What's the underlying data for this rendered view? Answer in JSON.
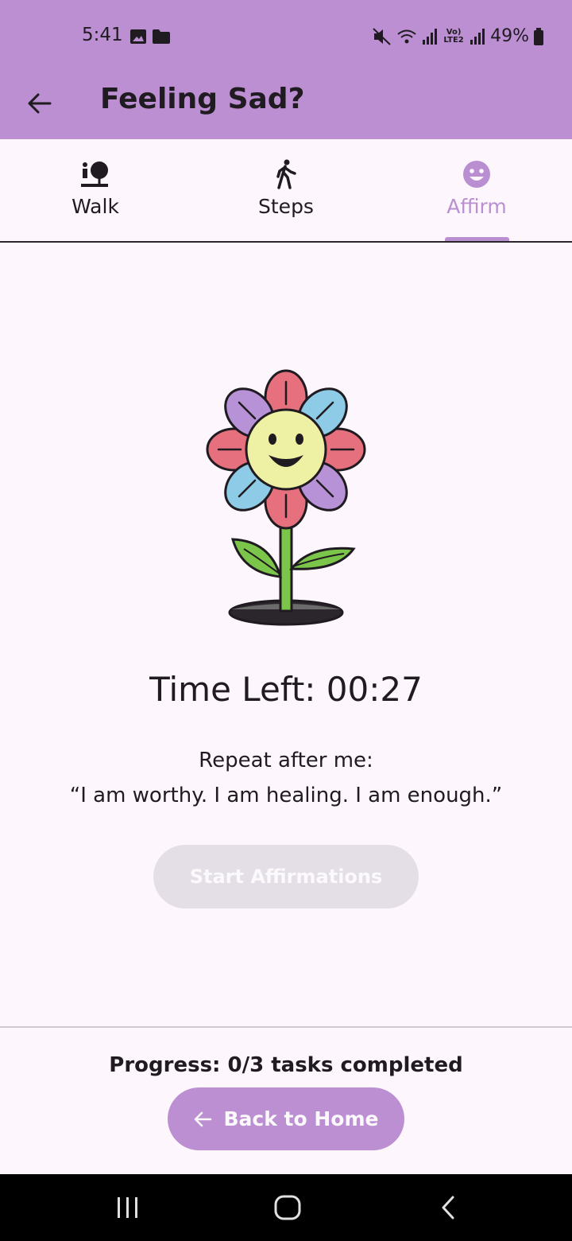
{
  "status": {
    "time": "5:41",
    "battery": "49%",
    "network_label": "Vo) LTE2"
  },
  "header": {
    "title": "Feeling Sad?"
  },
  "tabs": [
    {
      "label": "Walk",
      "icon": "walk-with-tree-icon",
      "active": false
    },
    {
      "label": "Steps",
      "icon": "person-walking-icon",
      "active": false
    },
    {
      "label": "Affirm",
      "icon": "smiley-face-icon",
      "active": true
    }
  ],
  "main": {
    "timer": "Time Left: 00:27",
    "instruction": "Repeat after me:",
    "affirmation": "“I am worthy. I am healing. I am enough.”",
    "start_button": "Start Affirmations",
    "start_button_enabled": false
  },
  "footer": {
    "progress": "Progress: 0/3 tasks completed",
    "back_button": "Back to Home"
  },
  "colors": {
    "accent": "#bb8fd1",
    "background": "#fdf7fd",
    "disabled_button": "#e4dfe6"
  }
}
